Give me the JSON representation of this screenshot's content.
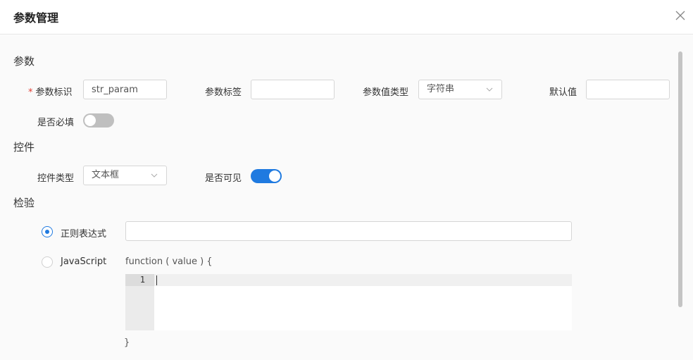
{
  "dialog": {
    "title": "参数管理",
    "close_icon": "close-icon"
  },
  "params_section": {
    "title": "参数",
    "param_key_label": "参数标识",
    "param_key_required_mark": "*",
    "param_key_value": "str_param",
    "param_label_label": "参数标签",
    "param_label_value": "",
    "value_type_label": "参数值类型",
    "value_type_selected": "字符串",
    "default_value_label": "默认值",
    "default_value_value": "",
    "required_label": "是否必填",
    "required_on": false
  },
  "control_section": {
    "title": "控件",
    "control_type_label": "控件类型",
    "control_type_selected": "文本框",
    "visible_label": "是否可见",
    "visible_on": true
  },
  "validation_section": {
    "title": "检验",
    "regex_label": "正则表达式",
    "regex_checked": true,
    "regex_value": "",
    "js_label": "JavaScript",
    "js_checked": false,
    "function_header": "function ( value ) {",
    "function_footer": "}",
    "editor_line_number": "1"
  },
  "colors": {
    "accent": "#1f7ae0",
    "required": "#e03c31"
  }
}
